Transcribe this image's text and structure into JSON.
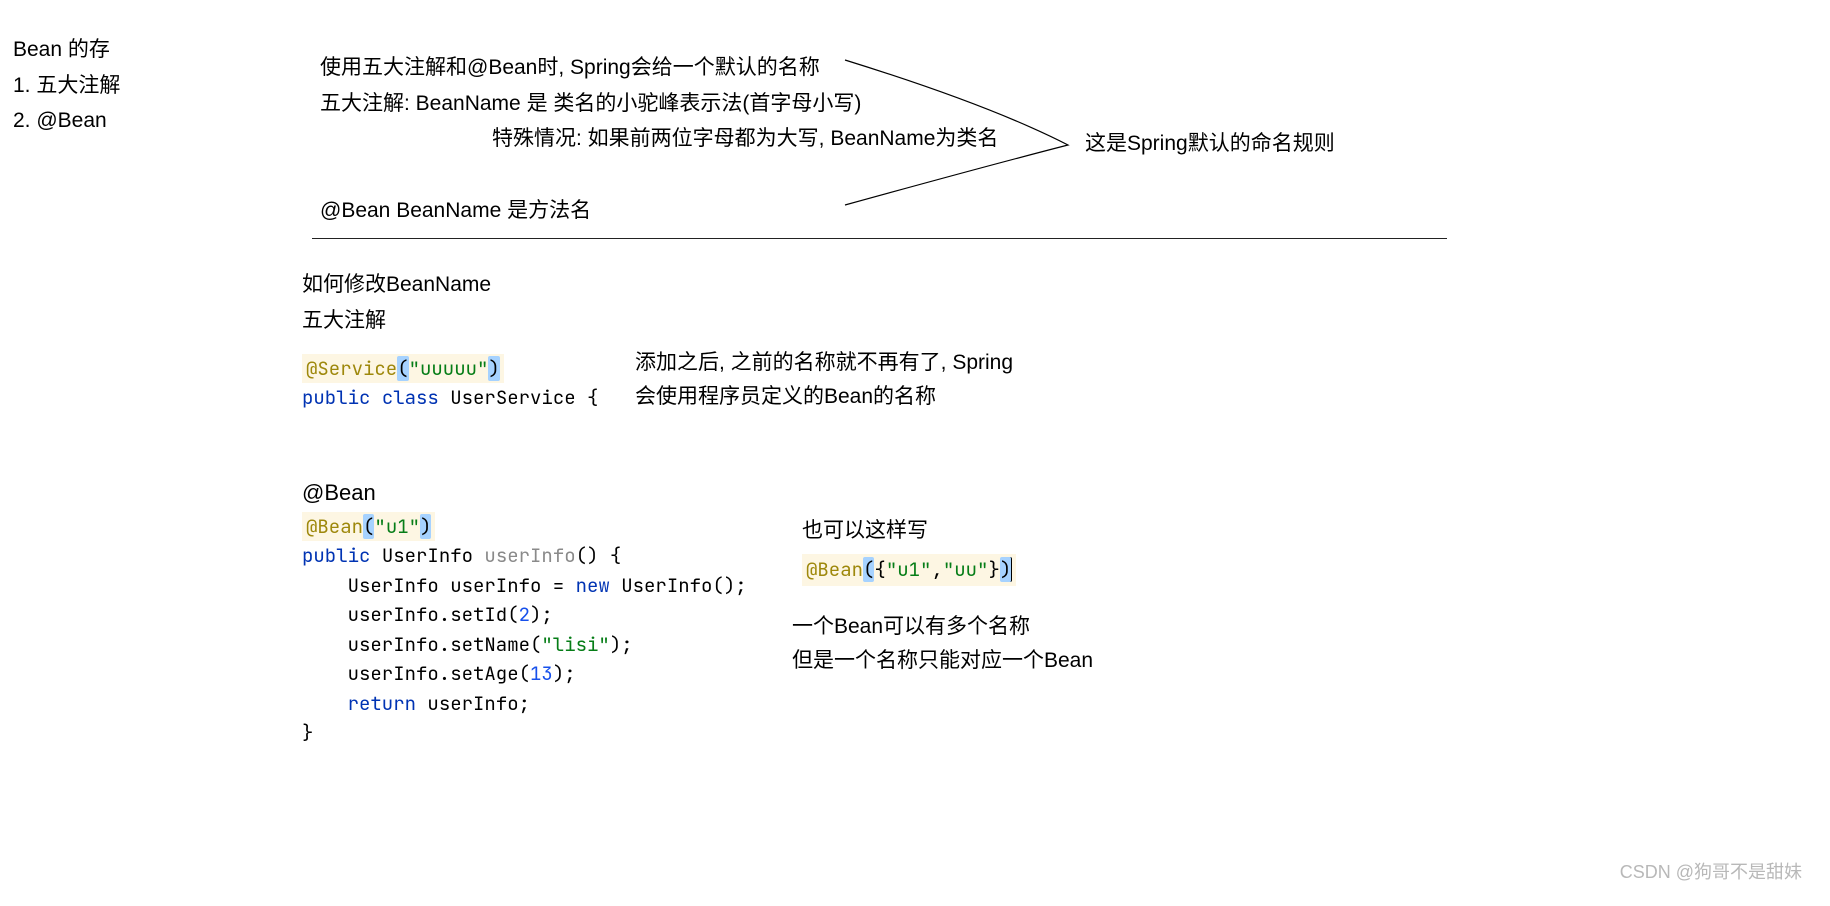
{
  "side_nav": {
    "title": "Bean 的存",
    "items": [
      "1. 五大注解",
      "2. @Bean"
    ]
  },
  "rules": {
    "line1": "使用五大注解和@Bean时, Spring会给一个默认的名称",
    "line2": "五大注解: BeanName 是 类名的小驼峰表示法(首字母小写)",
    "line3": "特殊情况: 如果前两位字母都为大写, BeanName为类名",
    "line4": "@Bean  BeanName 是方法名"
  },
  "annotation_text": "这是Spring默认的命名规则",
  "section2": {
    "heading1": "如何修改BeanName",
    "heading2": "五大注解",
    "explain_line1": "添加之后, 之前的名称就不再有了, Spring",
    "explain_line2": "会使用程序员定义的Bean的名称"
  },
  "code1": {
    "anno": "@Service",
    "anno_arg": "\"uuuuu\"",
    "decl_public": "public",
    "decl_class": "class",
    "decl_name": "UserService {"
  },
  "bean_section": {
    "heading": "@Bean"
  },
  "code2": {
    "anno": "@Bean",
    "anno_arg": "\"u1\"",
    "l2_public": "public",
    "l2_type": "UserInfo",
    "l2_fname": "userInfo",
    "l2_rest": "() {",
    "l3a": "    UserInfo userInfo = ",
    "l3_new": "new",
    "l3b": " UserInfo();",
    "l4a": "    userInfo.setId(",
    "l4_num": "2",
    "l4b": ");",
    "l5a": "    userInfo.setName(",
    "l5_str": "\"lisi\"",
    "l5b": ");",
    "l6a": "    userInfo.setAge(",
    "l6_num": "13",
    "l6b": ");",
    "l7_ret": "    return",
    "l7b": " userInfo;",
    "l8": "}"
  },
  "explain2": {
    "line1": "也可以这样写"
  },
  "code3": {
    "anno": "@Bean",
    "args_open": "({",
    "arg1": "\"u1\"",
    "comma": ",",
    "arg2": "\"uu\"",
    "args_close": "})"
  },
  "footnote": {
    "line1": "一个Bean可以有多个名称",
    "line2": "但是一个名称只能对应一个Bean"
  },
  "watermark": "CSDN @狗哥不是甜妹"
}
